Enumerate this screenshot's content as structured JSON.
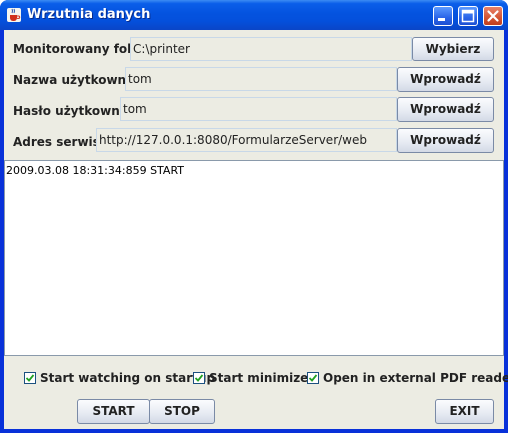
{
  "window": {
    "title": "Wrzutnia danych"
  },
  "form": {
    "folder_label": "Monitorowany folder",
    "folder_value": "C:\\printer",
    "folder_button": "Wybierz",
    "user_label": "Nazwa użytkownika",
    "user_value": "tom",
    "user_button": "Wprowadź",
    "password_label": "Hasło użytkownika",
    "password_value": "tom",
    "password_button": "Wprowadź",
    "service_label": "Adres serwisu",
    "service_value": "http://127.0.0.1:8080/FormularzeServer/web",
    "service_button": "Wprowadź"
  },
  "log": {
    "text": "2009.03.08 18:31:34:859 START"
  },
  "options": {
    "start_watching": {
      "label": "Start watching on startup",
      "checked": true
    },
    "start_minimized": {
      "label": "Start minimized",
      "checked": true
    },
    "open_external_pdf": {
      "label": "Open in external PDF reader",
      "checked": true
    }
  },
  "buttons": {
    "start": "START",
    "stop": "STOP",
    "exit": "EXIT"
  },
  "colors": {
    "titlebar": "#0a5ee9",
    "client_bg": "#ecece3",
    "close_button": "#d45533"
  },
  "icons": {
    "title": "java-cup-icon",
    "minimize": "minimize-icon",
    "maximize": "maximize-icon",
    "close": "close-icon",
    "checkbox": "checkmark-icon"
  }
}
